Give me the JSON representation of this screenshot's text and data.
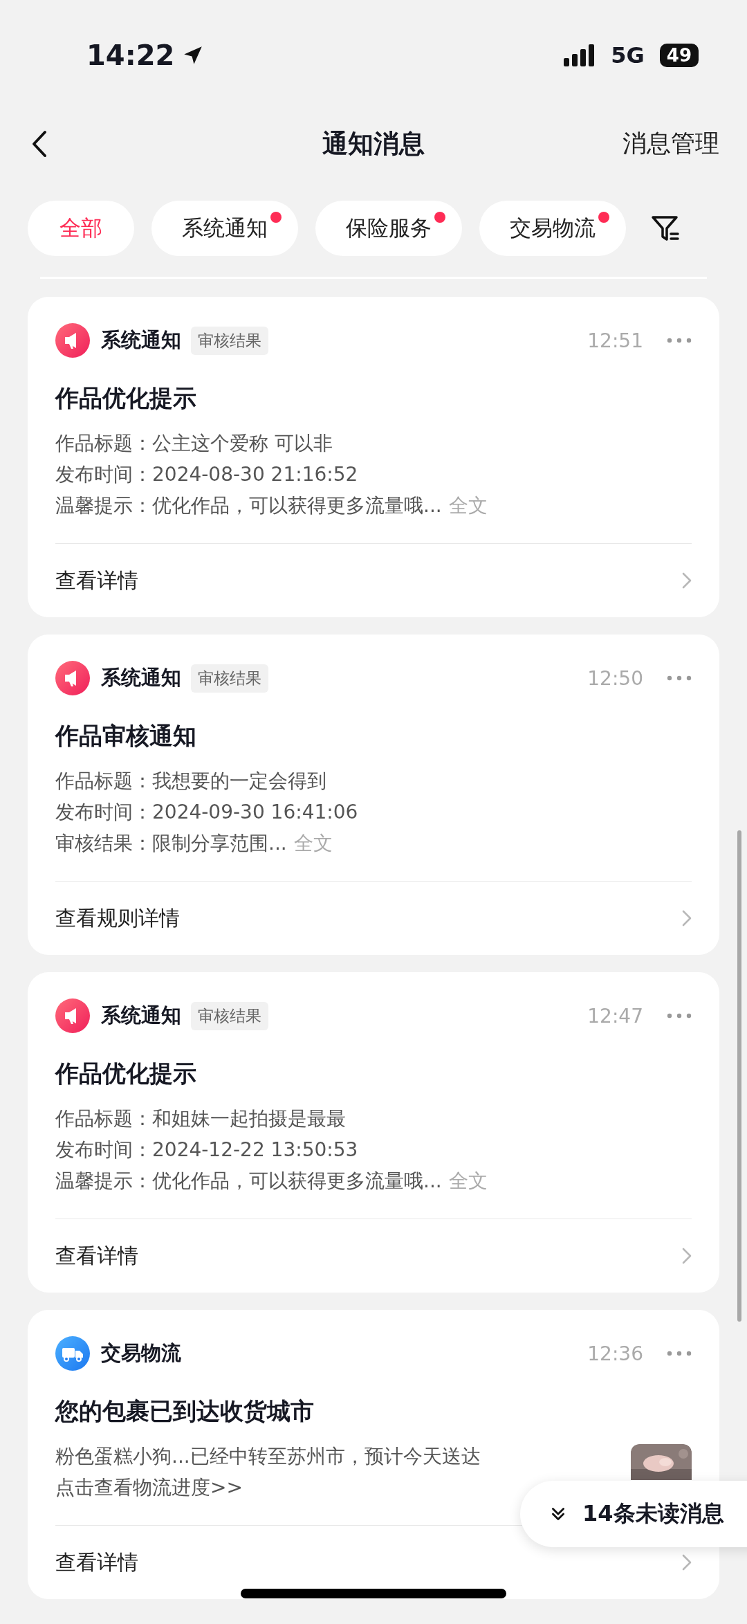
{
  "status_bar": {
    "time": "14:22",
    "network": "5G",
    "battery": "49"
  },
  "header": {
    "title": "通知消息",
    "action": "消息管理"
  },
  "tabs": [
    {
      "label": "全部",
      "selected": true,
      "unread": false
    },
    {
      "label": "系统通知",
      "selected": false,
      "unread": true
    },
    {
      "label": "保险服务",
      "selected": false,
      "unread": true
    },
    {
      "label": "交易物流",
      "selected": false,
      "unread": true
    }
  ],
  "cards": [
    {
      "kind": "system",
      "source": "系统通知",
      "tag": "审核结果",
      "time": "12:51",
      "title": "作品优化提示",
      "lines": [
        {
          "text": "作品标题：公主这个爱称 可以非"
        },
        {
          "text": "发布时间：2024-08-30 21:16:52"
        },
        {
          "text": "温馨提示：优化作品，可以获得更多流量哦...",
          "more": "全文"
        }
      ],
      "footer": "查看详情"
    },
    {
      "kind": "system",
      "source": "系统通知",
      "tag": "审核结果",
      "time": "12:50",
      "title": "作品审核通知",
      "lines": [
        {
          "text": "作品标题：我想要的一定会得到"
        },
        {
          "text": "发布时间：2024-09-30 16:41:06"
        },
        {
          "text": "审核结果：限制分享范围...",
          "more": "全文"
        }
      ],
      "footer": "查看规则详情"
    },
    {
      "kind": "system",
      "source": "系统通知",
      "tag": "审核结果",
      "time": "12:47",
      "title": "作品优化提示",
      "lines": [
        {
          "text": "作品标题：和姐妹一起拍摄是最最"
        },
        {
          "text": "发布时间：2024-12-22 13:50:53"
        },
        {
          "text": "温馨提示：优化作品，可以获得更多流量哦...",
          "more": "全文"
        }
      ],
      "footer": "查看详情"
    },
    {
      "kind": "logistics",
      "source": "交易物流",
      "time": "12:36",
      "title": "您的包裹已到达收货城市",
      "lines": [
        {
          "text": "粉色蛋糕小狗...已经中转至苏州市，预计今天送达"
        },
        {
          "text": "点击查看物流进度>>"
        }
      ],
      "thumbnail": {
        "kind": "picture"
      },
      "footer": "查看详情"
    }
  ],
  "unread_pill": {
    "label": "14条未读消息"
  }
}
